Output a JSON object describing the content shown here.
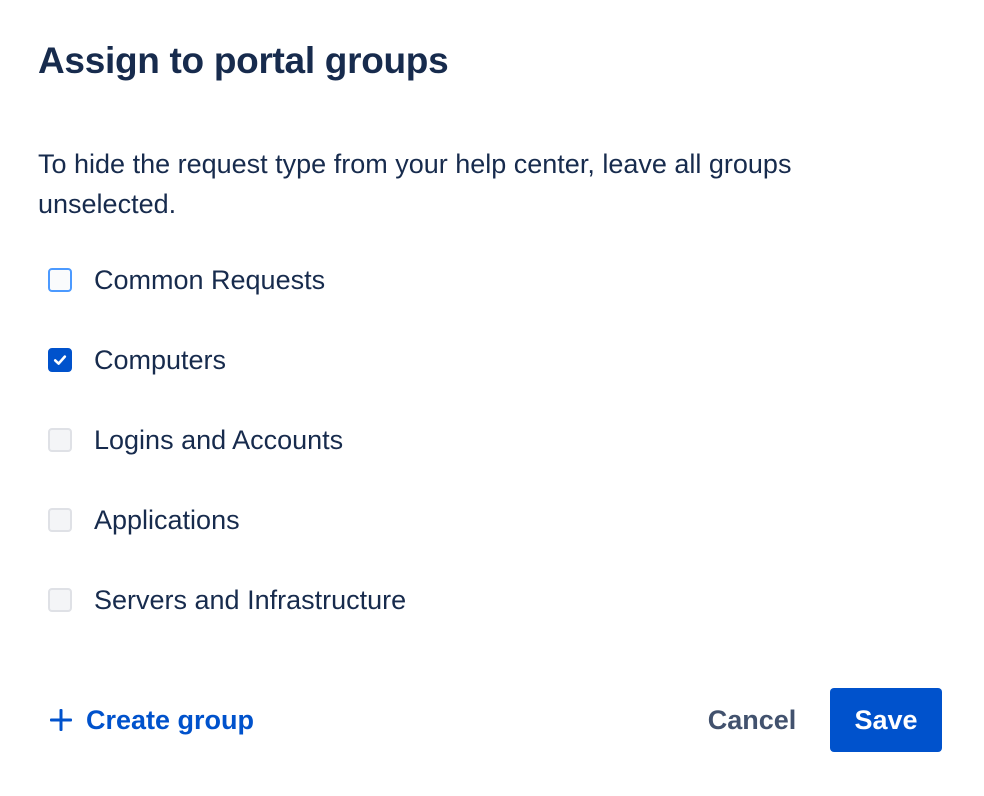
{
  "dialog": {
    "title": "Assign to portal groups",
    "description": "To hide the request type from your help center, leave all groups unselected."
  },
  "groups": [
    {
      "label": "Common Requests",
      "checked": false,
      "focused": true
    },
    {
      "label": "Computers",
      "checked": true,
      "focused": false
    },
    {
      "label": "Logins and Accounts",
      "checked": false,
      "focused": false
    },
    {
      "label": "Applications",
      "checked": false,
      "focused": false
    },
    {
      "label": "Servers and Infrastructure",
      "checked": false,
      "focused": false
    }
  ],
  "footer": {
    "create_group_label": "Create group",
    "create_group_icon": "plus-icon",
    "cancel_label": "Cancel",
    "save_label": "Save"
  },
  "colors": {
    "primary": "#0052cc",
    "text": "#172b4d",
    "subtle_text": "#42526e",
    "focus_ring": "#4c9aff",
    "checkbox_border": "#dfe1e6",
    "checkbox_bg": "#f4f5f7"
  }
}
